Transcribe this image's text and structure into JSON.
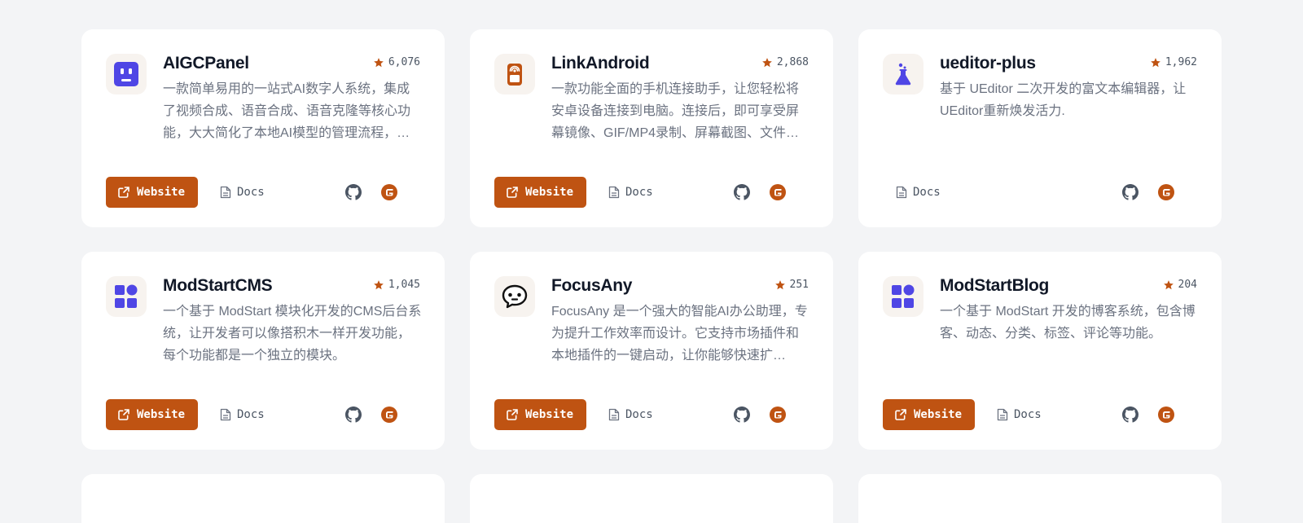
{
  "colors": {
    "accent": "#bf5312",
    "logo_purple": "#4f46e5",
    "background": "#f3f4f6"
  },
  "cards": [
    {
      "title": "AIGCPanel",
      "stars": "6,076",
      "logo_icon": "robot-face-icon",
      "desc": "一款简单易用的一站式AI数字人系统，集成了视频合成、语音合成、语音克隆等核心功能，大大简化了本地AI模型的管理流程，…",
      "website_label": "Website",
      "docs_label": "Docs",
      "has_website": true
    },
    {
      "title": "LinkAndroid",
      "stars": "2,868",
      "logo_icon": "phone-broadcast-icon",
      "desc": "一款功能全面的手机连接助手，让您轻松将安卓设备连接到电脑。连接后，即可享受屏幕镜像、GIF/MP4录制、屏幕截图、文件…",
      "website_label": "Website",
      "docs_label": "Docs",
      "has_website": true
    },
    {
      "title": "ueditor-plus",
      "stars": "1,962",
      "logo_icon": "flask-icon",
      "desc": "基于 UEditor 二次开发的富文本编辑器，让UEditor重新焕发活力.",
      "website_label": "",
      "docs_label": "Docs",
      "has_website": false
    },
    {
      "title": "ModStartCMS",
      "stars": "1,045",
      "logo_icon": "modules-grid-icon",
      "desc": "一个基于 ModStart 模块化开发的CMS后台系统，让开发者可以像搭积木一样开发功能，每个功能都是一个独立的模块。",
      "website_label": "Website",
      "docs_label": "Docs",
      "has_website": true
    },
    {
      "title": "FocusAny",
      "stars": "251",
      "logo_icon": "chat-bubble-face-icon",
      "desc": "FocusAny 是一个强大的智能AI办公助理，专为提升工作效率而设计。它支持市场插件和本地插件的一键启动，让你能够快速扩…",
      "website_label": "Website",
      "docs_label": "Docs",
      "has_website": true
    },
    {
      "title": "ModStartBlog",
      "stars": "204",
      "logo_icon": "modules-grid-icon",
      "desc": "一个基于 ModStart 开发的博客系统，包含博客、动态、分类、标签、评论等功能。",
      "website_label": "Website",
      "docs_label": "Docs",
      "has_website": true
    }
  ]
}
